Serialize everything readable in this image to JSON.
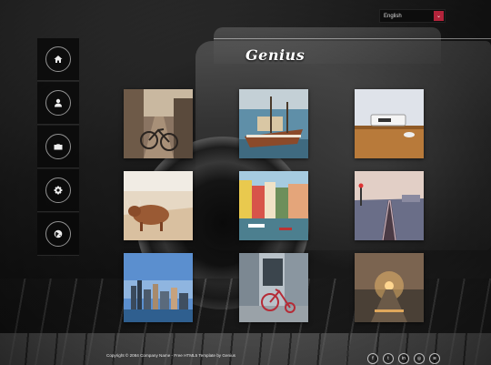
{
  "language_select": {
    "selected": "English",
    "arrow_glyph": "⌄"
  },
  "logo": {
    "text": "Genius"
  },
  "sidebar": {
    "items": [
      {
        "icon": "home-icon"
      },
      {
        "icon": "user-icon"
      },
      {
        "icon": "briefcase-icon"
      },
      {
        "icon": "gear-icon"
      },
      {
        "icon": "globe-icon"
      }
    ]
  },
  "gallery": {
    "items": [
      {
        "subject": "bicycle-street"
      },
      {
        "subject": "boat-harbor"
      },
      {
        "subject": "desk-laptop"
      },
      {
        "subject": "highland-cow"
      },
      {
        "subject": "canal-houses"
      },
      {
        "subject": "railway-tracks"
      },
      {
        "subject": "city-skyline"
      },
      {
        "subject": "red-tricycle"
      },
      {
        "subject": "foggy-road"
      }
    ]
  },
  "footer": {
    "copyright": "Copyright © 2084 Company Name - Free HTML5 Template by Genius",
    "socials": [
      {
        "icon": "facebook-icon",
        "glyph": "f"
      },
      {
        "icon": "twitter-icon",
        "glyph": "t"
      },
      {
        "icon": "linkedin-icon",
        "glyph": "in"
      },
      {
        "icon": "instagram-icon",
        "glyph": "◎"
      },
      {
        "icon": "rss-icon",
        "glyph": "≋"
      }
    ]
  }
}
